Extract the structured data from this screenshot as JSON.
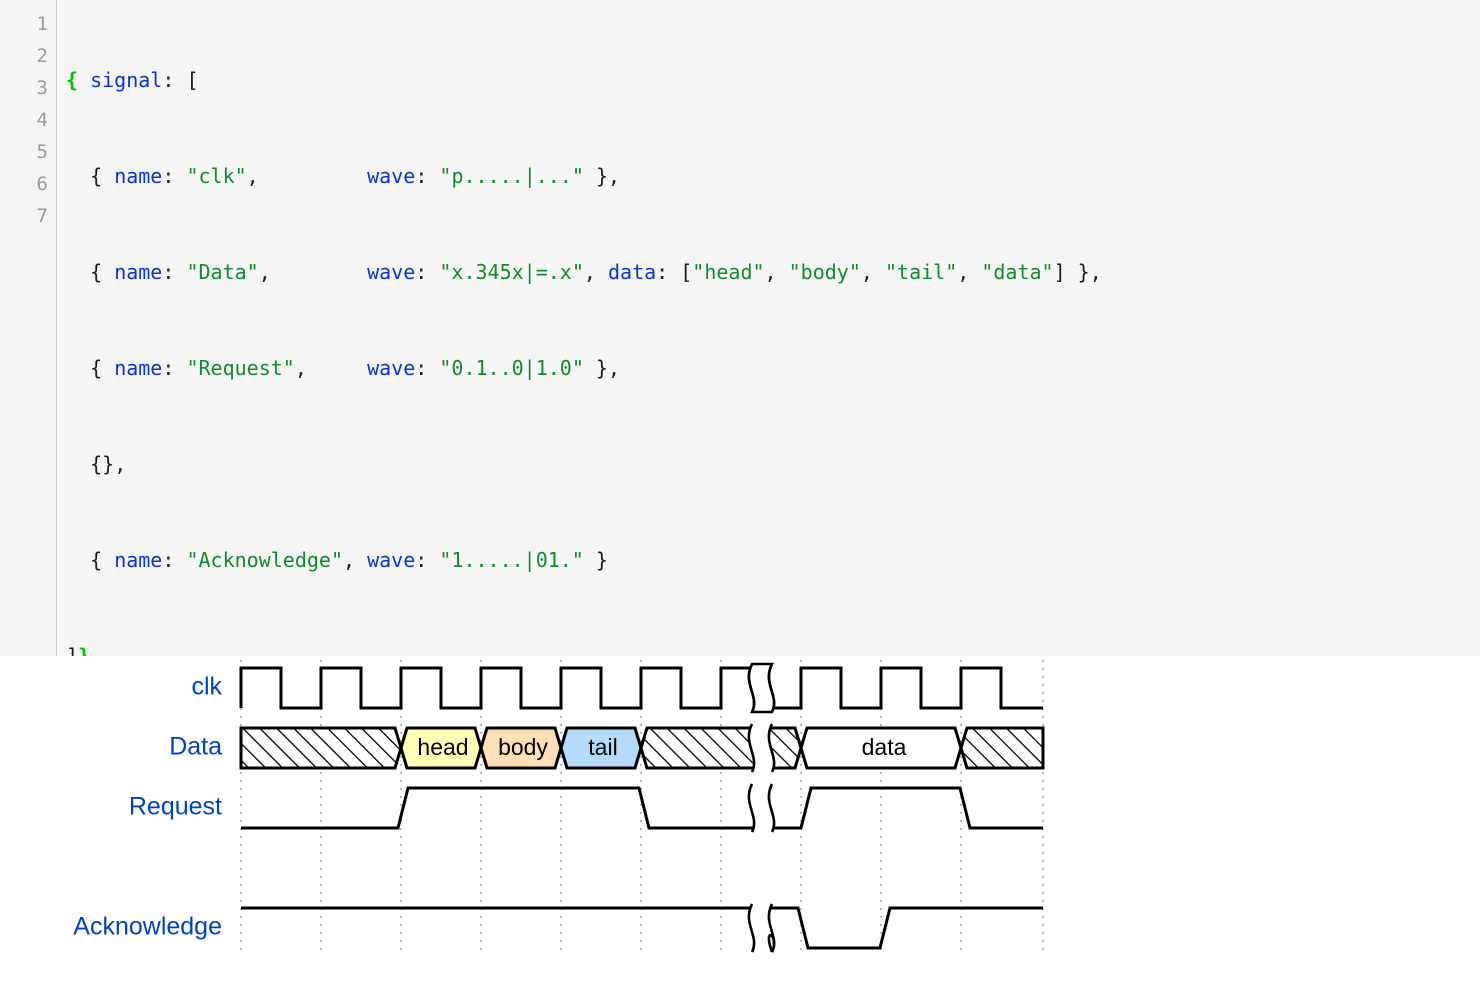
{
  "editor": {
    "gutter_numbers": [
      "1",
      "2",
      "3",
      "4",
      "5",
      "6",
      "7"
    ],
    "lines": [
      "{ signal: [",
      "  { name: \"clk\",         wave: \"p.....|...\" },",
      "  { name: \"Data\",        wave: \"x.345x|=.x\", data: [\"head\", \"body\", \"tail\", \"data\"] },",
      "  { name: \"Request\",     wave: \"0.1..0|1.0\" },",
      "  {},",
      "  { name: \"Acknowledge\", wave: \"1.....|01.\" }",
      "]}"
    ],
    "source_object": {
      "signal": [
        {
          "name": "clk",
          "wave": "p.....|..."
        },
        {
          "name": "Data",
          "wave": "x.345x|=.x",
          "data": [
            "head",
            "body",
            "tail",
            "data"
          ]
        },
        {
          "name": "Request",
          "wave": "0.1..0|1.0"
        },
        {},
        {
          "name": "Acknowledge",
          "wave": "1.....|01."
        }
      ]
    },
    "colors": {
      "background": "#f5f5f5",
      "gutter_text": "#9a9a9a",
      "keyword": "#0b31d6",
      "string": "#118a2e",
      "punctuation": "#1c1c1c",
      "matching_brace": "#00c000"
    }
  },
  "diagram": {
    "background": "#ffffff",
    "label_color": "#0041c4",
    "signals": [
      {
        "name": "clk",
        "wave": "p.....|..."
      },
      {
        "name": "Data",
        "wave": "x.345x|=.x",
        "data": [
          "head",
          "body",
          "tail",
          "data"
        ]
      },
      {
        "name": "Request",
        "wave": "0.1..0|1.0"
      },
      {
        "name": "",
        "wave": ""
      },
      {
        "name": "Acknowledge",
        "wave": "1.....|01."
      }
    ],
    "bus_segments": [
      {
        "label": "head",
        "fill": "#ffffb4"
      },
      {
        "label": "body",
        "fill": "#ffdfb4"
      },
      {
        "label": "tail",
        "fill": "#b4dcfa"
      },
      {
        "label": "data",
        "fill": "#ffffff"
      }
    ],
    "cycles": 10,
    "gap_marker_cycle": 6,
    "fill_colors": {
      "data2_head": "#ffffb4",
      "data3_body": "#ffdfb4",
      "data4_tail": "#b4dcfa",
      "data_eq": "#ffffff",
      "undefined_hatch": "#ffffff"
    }
  }
}
